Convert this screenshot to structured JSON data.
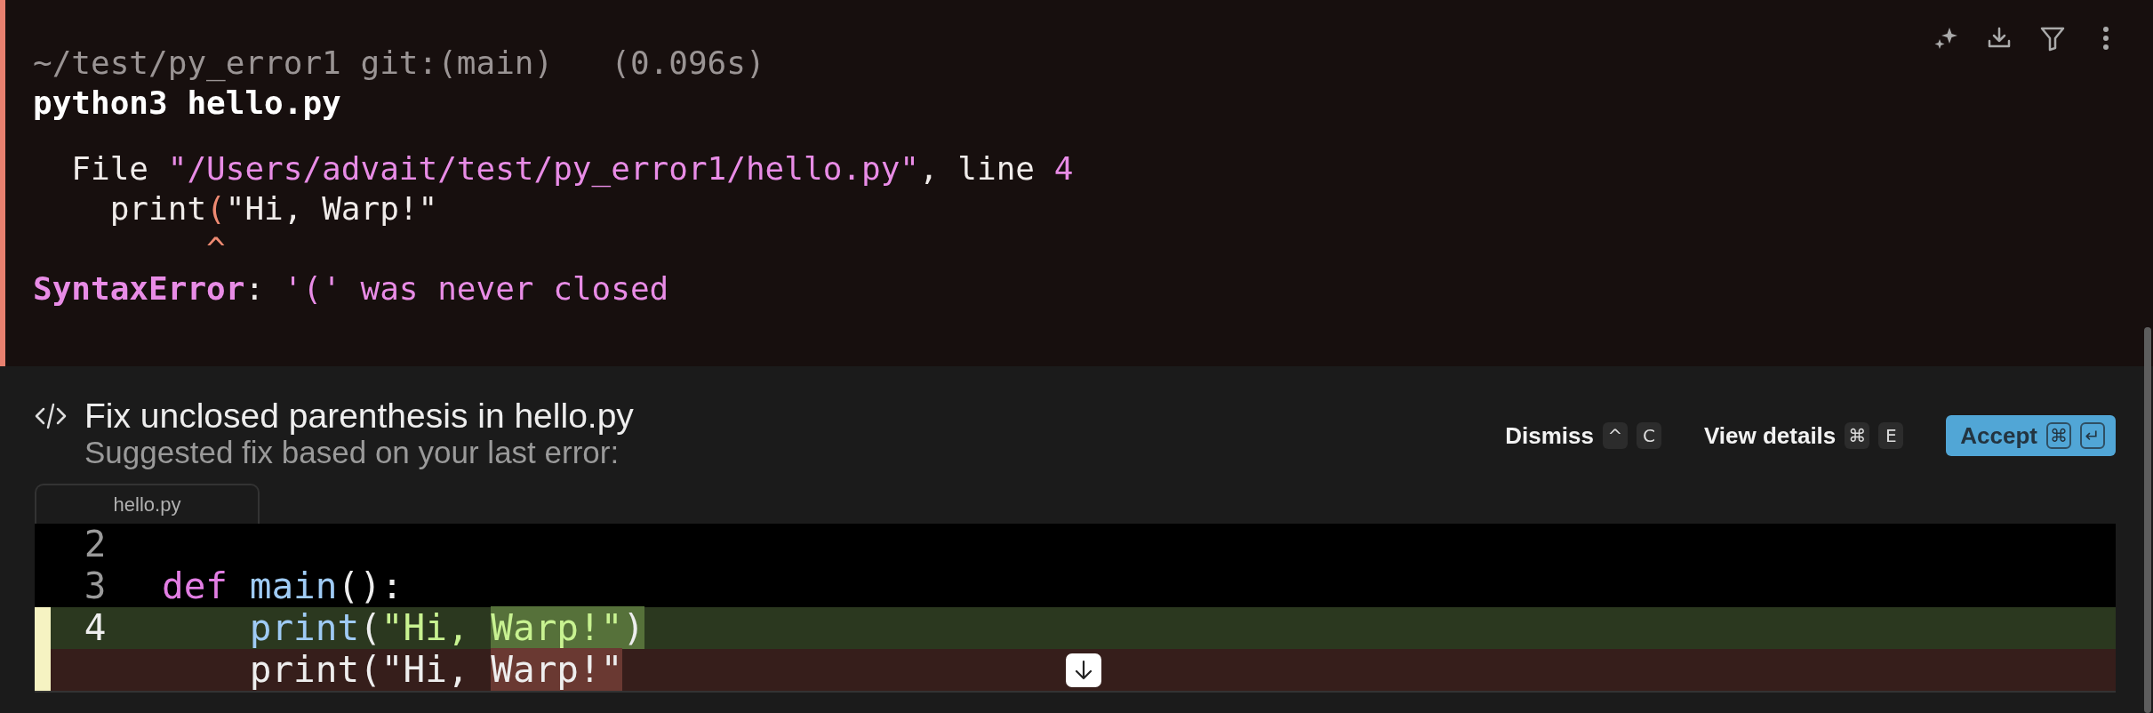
{
  "block": {
    "prompt": {
      "path": "~/test/py_error1",
      "git": "git:(main)",
      "duration": "(0.096s)"
    },
    "command": "python3 hello.py",
    "output": [
      {
        "segments": [
          {
            "text": "  File ",
            "kind": "plain"
          },
          {
            "text": "\"/Users/advait/test/py_error1/hello.py\"",
            "kind": "accent"
          },
          {
            "text": ", line ",
            "kind": "plain"
          },
          {
            "text": "4",
            "kind": "accent"
          }
        ]
      },
      {
        "segments": [
          {
            "text": "    print",
            "kind": "plain"
          },
          {
            "text": "(",
            "kind": "marker"
          },
          {
            "text": "\"Hi, Warp!\"",
            "kind": "plain"
          }
        ]
      },
      {
        "segments": [
          {
            "text": "         ^",
            "kind": "marker"
          }
        ]
      },
      {
        "segments": [
          {
            "text": "SyntaxError",
            "kind": "error"
          },
          {
            "text": ": ",
            "kind": "plain"
          },
          {
            "text": "'(' was never closed",
            "kind": "accent"
          }
        ]
      }
    ]
  },
  "suggestion": {
    "title": "Fix unclosed parenthesis in hello.py",
    "subtitle": "Suggested fix based on your last error:",
    "actions": [
      {
        "label": "Dismiss",
        "kind": "secondary",
        "keys": [
          "^",
          "C"
        ]
      },
      {
        "label": "View details",
        "kind": "secondary",
        "keys": [
          "⌘",
          "E"
        ]
      },
      {
        "label": "Accept",
        "kind": "primary",
        "keys": [
          "⌘",
          "↵"
        ]
      }
    ],
    "file_tab": "hello.py",
    "lines": [
      {
        "number": "2",
        "kind": "context"
      },
      {
        "number": "3",
        "kind": "context",
        "segments": [
          {
            "text": "def",
            "kind": "keyword"
          },
          {
            "text": " main",
            "kind": "function"
          },
          {
            "text": "():",
            "kind": "plain"
          }
        ]
      },
      {
        "number": "4",
        "kind": "added",
        "segments": [
          {
            "text": "    print",
            "kind": "function"
          },
          {
            "text": "(",
            "kind": "plain"
          },
          {
            "text": "\"Hi, ",
            "kind": "string"
          },
          {
            "text": "Warp!\"",
            "kind": "changed-string"
          },
          {
            "text": ")",
            "kind": "changed-plain"
          }
        ]
      },
      {
        "kind": "removed",
        "segments": [
          {
            "text": "    print(\"Hi, ",
            "kind": "plain"
          },
          {
            "text": "Warp!\"",
            "kind": "changed-plain"
          }
        ]
      }
    ]
  }
}
